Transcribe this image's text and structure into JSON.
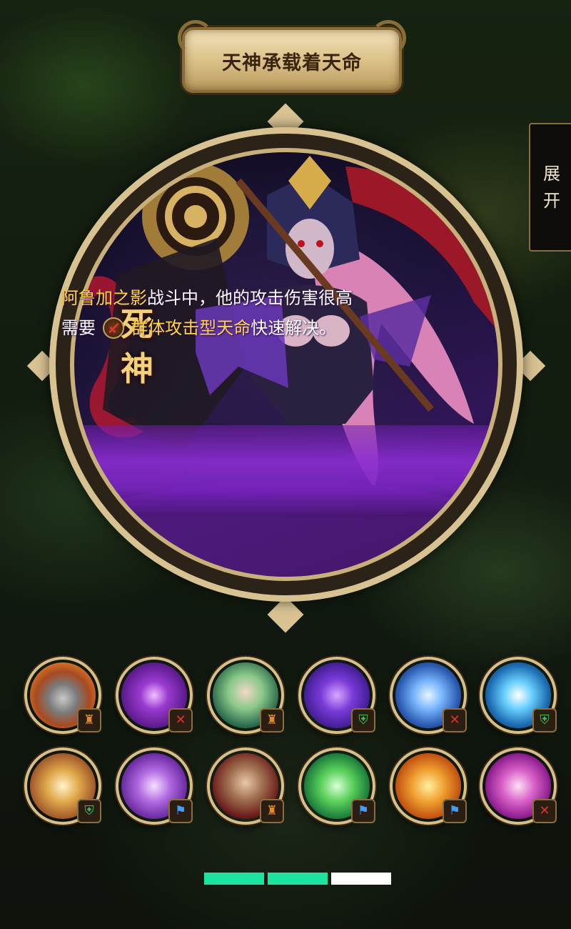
{
  "header": {
    "title": "天神承载着天命"
  },
  "side_tab": {
    "label_line1": "展",
    "label_line2": "开"
  },
  "hero": {
    "name_line1": "死",
    "name_line2": "神",
    "desc_highlight1": "阿鲁加之影",
    "desc_text1": "战斗中，他的攻击伤害很高",
    "desc_text2": "需要",
    "desc_highlight2": "群体攻击型天命",
    "desc_text3": "快速解决。"
  },
  "icons": [
    {
      "name": "knight-helmet",
      "role": "tank",
      "badge_glyph": "♜"
    },
    {
      "name": "purple-orb",
      "role": "dps",
      "badge_glyph": "✕"
    },
    {
      "name": "green-hooded-girl",
      "role": "tank",
      "badge_glyph": "♜"
    },
    {
      "name": "violet-vortex",
      "role": "support",
      "badge_glyph": "⛨"
    },
    {
      "name": "lightning-sword",
      "role": "dps",
      "badge_glyph": "✕"
    },
    {
      "name": "blue-cross",
      "role": "support",
      "badge_glyph": "⛨"
    },
    {
      "name": "golden-light-beam",
      "role": "support",
      "badge_glyph": "⛨"
    },
    {
      "name": "purple-clock",
      "role": "control",
      "badge_glyph": "⚑"
    },
    {
      "name": "old-captain",
      "role": "tank",
      "badge_glyph": "♜"
    },
    {
      "name": "green-clover",
      "role": "control",
      "badge_glyph": "⚑"
    },
    {
      "name": "fire-emblem",
      "role": "control",
      "badge_glyph": "⚑"
    },
    {
      "name": "pink-ring",
      "role": "dps",
      "badge_glyph": "✕"
    }
  ],
  "pager": {
    "pages": 3,
    "active": [
      0,
      1
    ],
    "active_color": "#1ee2a0",
    "inactive_color": "#ffffff"
  }
}
